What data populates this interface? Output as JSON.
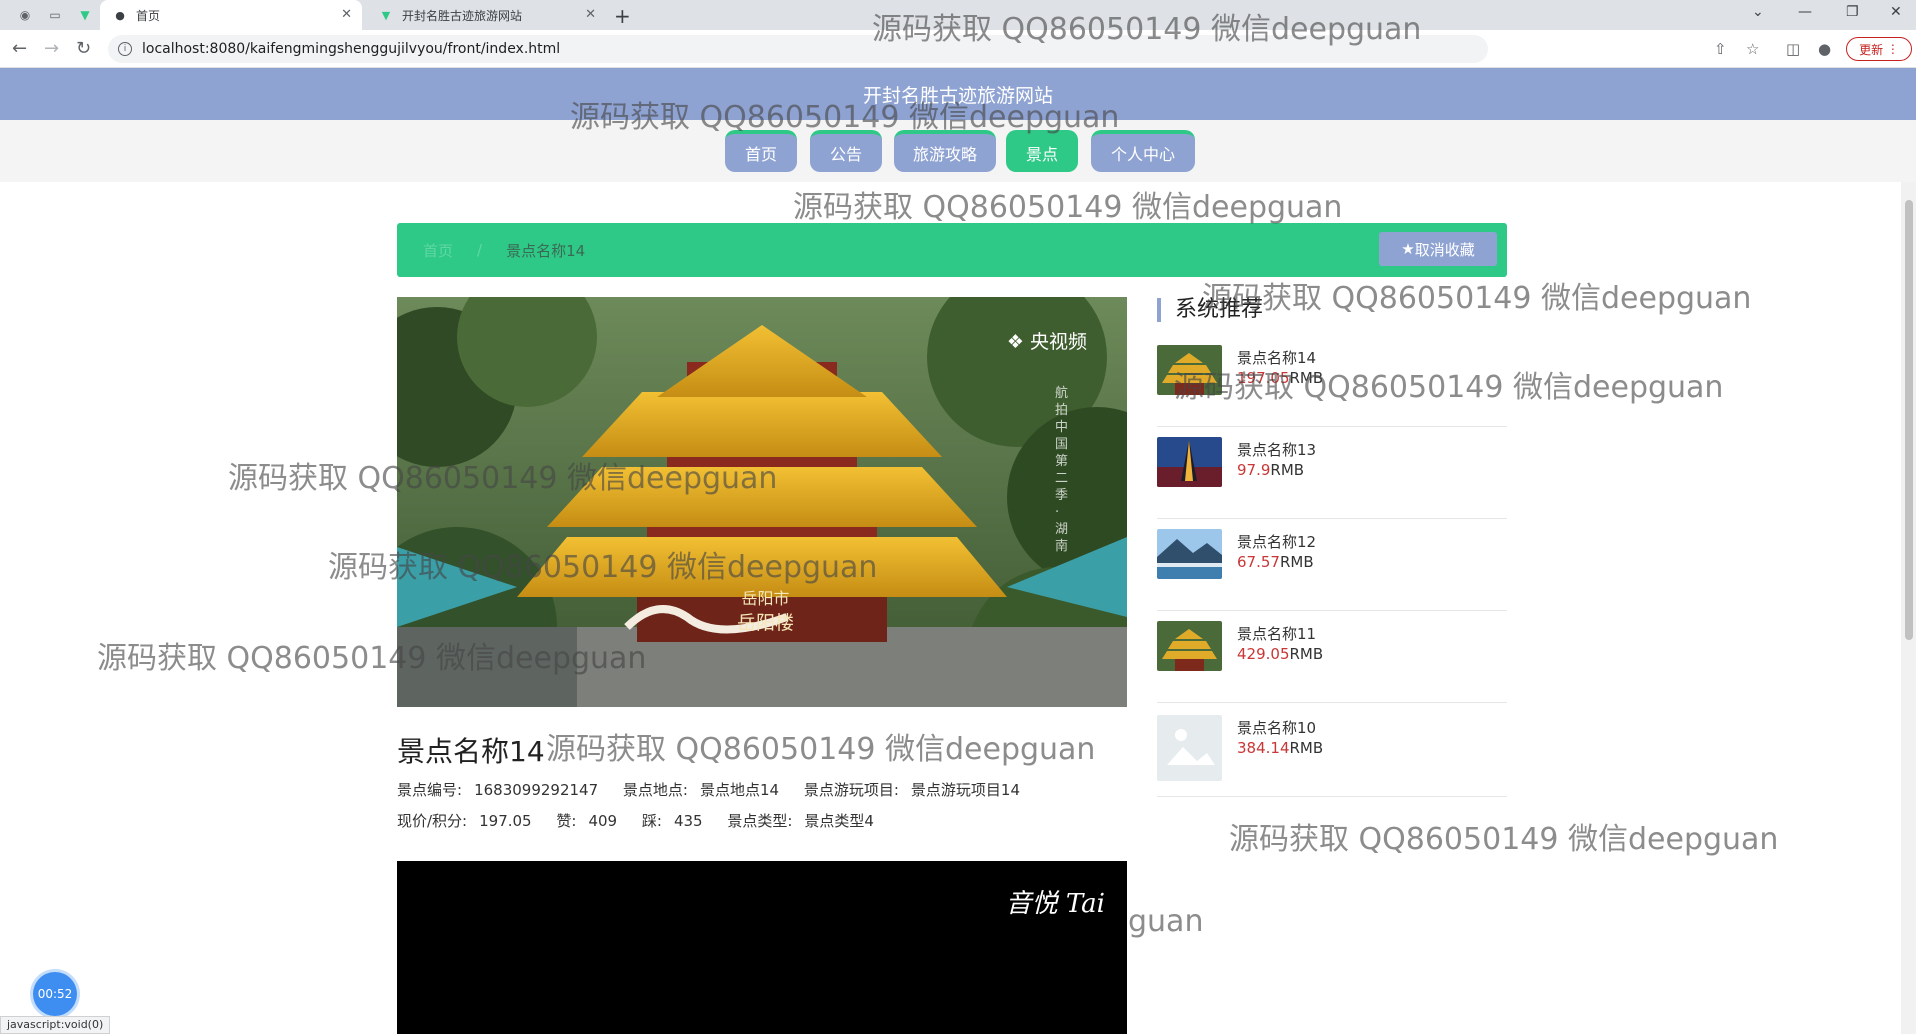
{
  "browser": {
    "tabs": [
      {
        "title": "首页",
        "active": true
      },
      {
        "title": "开封名胜古迹旅游网站",
        "active": false
      }
    ],
    "url": "localhost:8080/kaifengmingshenggujilvyou/front/index.html",
    "update_label": "更新"
  },
  "site": {
    "title": "开封名胜古迹旅游网站",
    "nav": [
      "首页",
      "公告",
      "旅游攻略",
      "景点",
      "个人中心"
    ]
  },
  "breadcrumb": {
    "home": "首页",
    "separator": "/",
    "current": "景点名称14",
    "favorite_label": "取消收藏"
  },
  "image_overlay": {
    "logo_text": "央视频",
    "vertical_text": "航拍中国 第二季 · 湖南",
    "caption_line1": "岳阳市",
    "caption_line2": "岳阳楼"
  },
  "detail": {
    "title": "景点名称14",
    "number_label": "景点编号:",
    "number": "1683099292147",
    "location_label": "景点地点:",
    "location": "景点地点14",
    "project_label": "景点游玩项目:",
    "project": "景点游玩项目14",
    "price_label": "现价/积分:",
    "price": "197.05",
    "like_label": "赞:",
    "like": "409",
    "dislike_label": "踩:",
    "dislike": "435",
    "type_label": "景点类型:",
    "type": "景点类型4"
  },
  "video": {
    "caption": "音悦 Tai"
  },
  "recommend": {
    "heading": "系统推荐",
    "currency": "RMB",
    "items": [
      {
        "name": "景点名称14",
        "price": "197.05"
      },
      {
        "name": "景点名称13",
        "price": "97.9"
      },
      {
        "name": "景点名称12",
        "price": "67.57"
      },
      {
        "name": "景点名称11",
        "price": "429.05"
      },
      {
        "name": "景点名称10",
        "price": "384.14"
      }
    ]
  },
  "watermark_text": "源码获取 QQ86050149 微信deepguan",
  "watermark_partial": "guan",
  "timer": "00:52",
  "status_bar": "javascript:void(0)",
  "colors": {
    "brand_lavender": "#8fa3d3",
    "brand_green": "#2fc987",
    "price_red": "#c93636"
  }
}
